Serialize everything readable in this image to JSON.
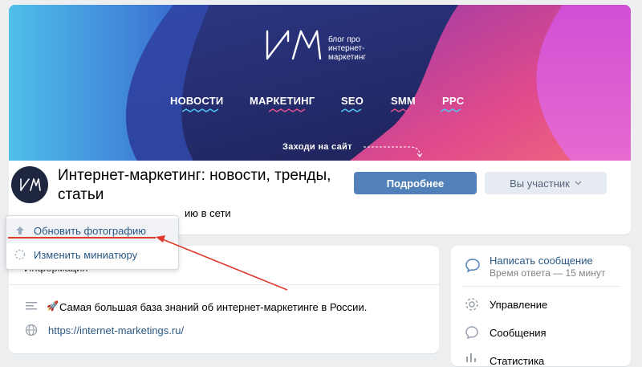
{
  "cover": {
    "logo_text": "блог про\nинтернет-\nмаркетинг",
    "nav": [
      "НОВОСТИ",
      "МАРКЕТИНГ",
      "SEO",
      "SMM",
      "PPC"
    ],
    "cta": "Заходи на сайт"
  },
  "header": {
    "title": "Интернет-маркетинг: новости, тренды, статьи",
    "status": "ию в сети",
    "more_button": "Подробнее",
    "member_button": "Вы участник"
  },
  "photo_menu": {
    "update": "Обновить фотографию",
    "thumbnail": "Изменить миниатюру"
  },
  "info": {
    "heading": "Информация",
    "description": "Самая большая база знаний об интернет-маркетинге в России.",
    "emoji": "🚀",
    "link": "https://internet-marketings.ru/"
  },
  "side": {
    "message_title": "Написать сообщение",
    "message_sub": "Время ответа — 15 минут",
    "items": [
      "Управление",
      "Сообщения",
      "Статистика"
    ]
  },
  "colors": {
    "accent": "#5181b8",
    "link": "#2a5885",
    "annotation": "#e03a2f"
  }
}
